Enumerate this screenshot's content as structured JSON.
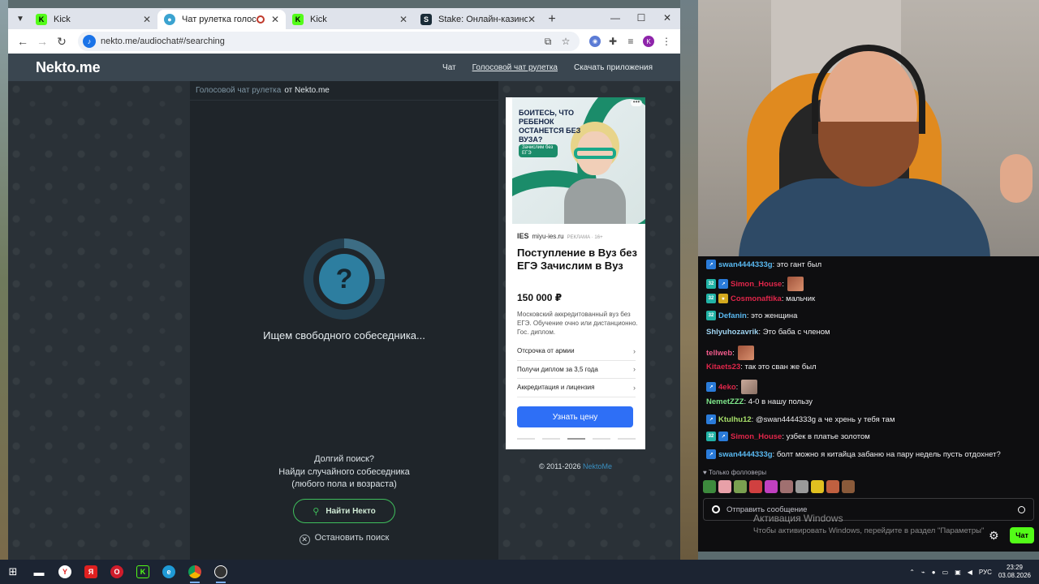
{
  "browser": {
    "tabs": [
      {
        "title": "Kick",
        "favicon": "kick-icon",
        "active": false
      },
      {
        "title": "Чат рулетка голосовая — ",
        "favicon": "nekto-icon",
        "active": true,
        "recording": true
      },
      {
        "title": "Kick",
        "favicon": "kick-icon",
        "active": false
      },
      {
        "title": "Stake: Онлайн-казино и ставк",
        "favicon": "stake-icon",
        "active": false
      }
    ],
    "url": "nekto.me/audiochat#/searching",
    "profile_letter": "K"
  },
  "site": {
    "logo": "Nekto.me",
    "nav": [
      "Чат",
      "Голосовой чат рулетка",
      "Скачать приложения"
    ],
    "breadcrumb_link": "Голосовой чат рулетка",
    "breadcrumb_rest": "от Nekto.me",
    "spinner_symbol": "?",
    "searching_text": "Ищем свободного собеседника...",
    "long_search_lines": [
      "Долгий поиск?",
      "Найди случайного собеседника",
      "(любого пола и возраста)"
    ],
    "find_button": "Найти Некто",
    "stop_button": "Остановить поиск",
    "copyright": "© 2011-2026",
    "copyright_link": "NektoMe"
  },
  "ad": {
    "image_headline": "БОИТЕСЬ, ЧТО РЕБЕНОК ОСТАНЕТСЯ БЕЗ ВУЗА?",
    "image_pill": "Зачислим без ЕГЭ",
    "source_logo": "IES",
    "source_domain": "miyu-ies.ru",
    "source_tag": "РЕКЛАМА · 16+",
    "title": "Поступление в Вуз без ЕГЭ Зачислим в Вуз",
    "price": "150 000 ₽",
    "description": "Московский аккредитованный вуз без ЕГЭ. Обучение очно или дистанционно. Гос. диплом.",
    "links": [
      "Отсрочка от армии",
      "Получи диплом за 3,5 года",
      "Аккредитация и лицензия"
    ],
    "cta": "Узнать цену"
  },
  "chat": {
    "messages": [
      {
        "badges": [
          "m"
        ],
        "user": "swan4444333g",
        "color": "#59b8f0",
        "text": ": это гант был",
        "emote": false
      },
      {
        "badges": [
          "s",
          "m"
        ],
        "user": "Simon_House",
        "color": "#e0264a",
        "text": ":",
        "emote": true
      },
      {
        "badges": [
          "s",
          "g"
        ],
        "user": "Cosmonaftika",
        "color": "#e0264a",
        "text": ": мальчик",
        "emote": false
      },
      {
        "badges": [
          "s"
        ],
        "user": "Defanin",
        "color": "#59b8f0",
        "text": ": это женщина",
        "emote": false
      },
      {
        "badges": [],
        "user": "Shlyuhozavrik",
        "color": "#9fd3f0",
        "text": ": Это баба с членом",
        "emote": false
      },
      {
        "badges": [],
        "user": "tellweb",
        "color": "#f05a8a",
        "text": ":",
        "emote": true
      },
      {
        "badges": [],
        "user": "Kitaets23",
        "color": "#e0264a",
        "text": ": так это сван же был",
        "emote": false
      },
      {
        "badges": [
          "m"
        ],
        "user": "4eko",
        "color": "#e0264a",
        "text": ":",
        "emote": true
      },
      {
        "badges": [],
        "user": "NemetZZZ",
        "color": "#7ee68a",
        "text": ": 4-0 в нашу пользу",
        "emote": false
      },
      {
        "badges": [
          "m"
        ],
        "user": "Ktulhu12",
        "color": "#a8e06a",
        "text": ": @swan4444333g а че хрень у тебя там",
        "emote": false
      },
      {
        "badges": [
          "s",
          "m"
        ],
        "user": "Simon_House",
        "color": "#e0264a",
        "text": ": узбек в платье золотом",
        "emote": false
      },
      {
        "badges": [
          "m"
        ],
        "user": "swan4444333g",
        "color": "#59b8f0",
        "text": ": болт можно я китайца забаню на пару недель пусть отдохнет?",
        "emote": false
      }
    ],
    "badge_labels": {
      "s": "32",
      "g": "★",
      "m": "↗"
    },
    "followers_only": "Только фолловеры",
    "emote_colors": [
      "#3d8a3d",
      "#e8a0a8",
      "#7aa050",
      "#d04040",
      "#c040c0",
      "#a07070",
      "#9a9a9a",
      "#e0c020",
      "#c06040",
      "#8a5a3a"
    ],
    "input_placeholder": "Отправить сообщение",
    "send_button": "Чат"
  },
  "watermark": {
    "title": "Активация Windows",
    "subtitle": "Чтобы активировать Windows, перейдите в раздел \"Параметры\""
  },
  "taskbar": {
    "language": "РУС",
    "time": "23:29",
    "date": "03.08.2026"
  }
}
